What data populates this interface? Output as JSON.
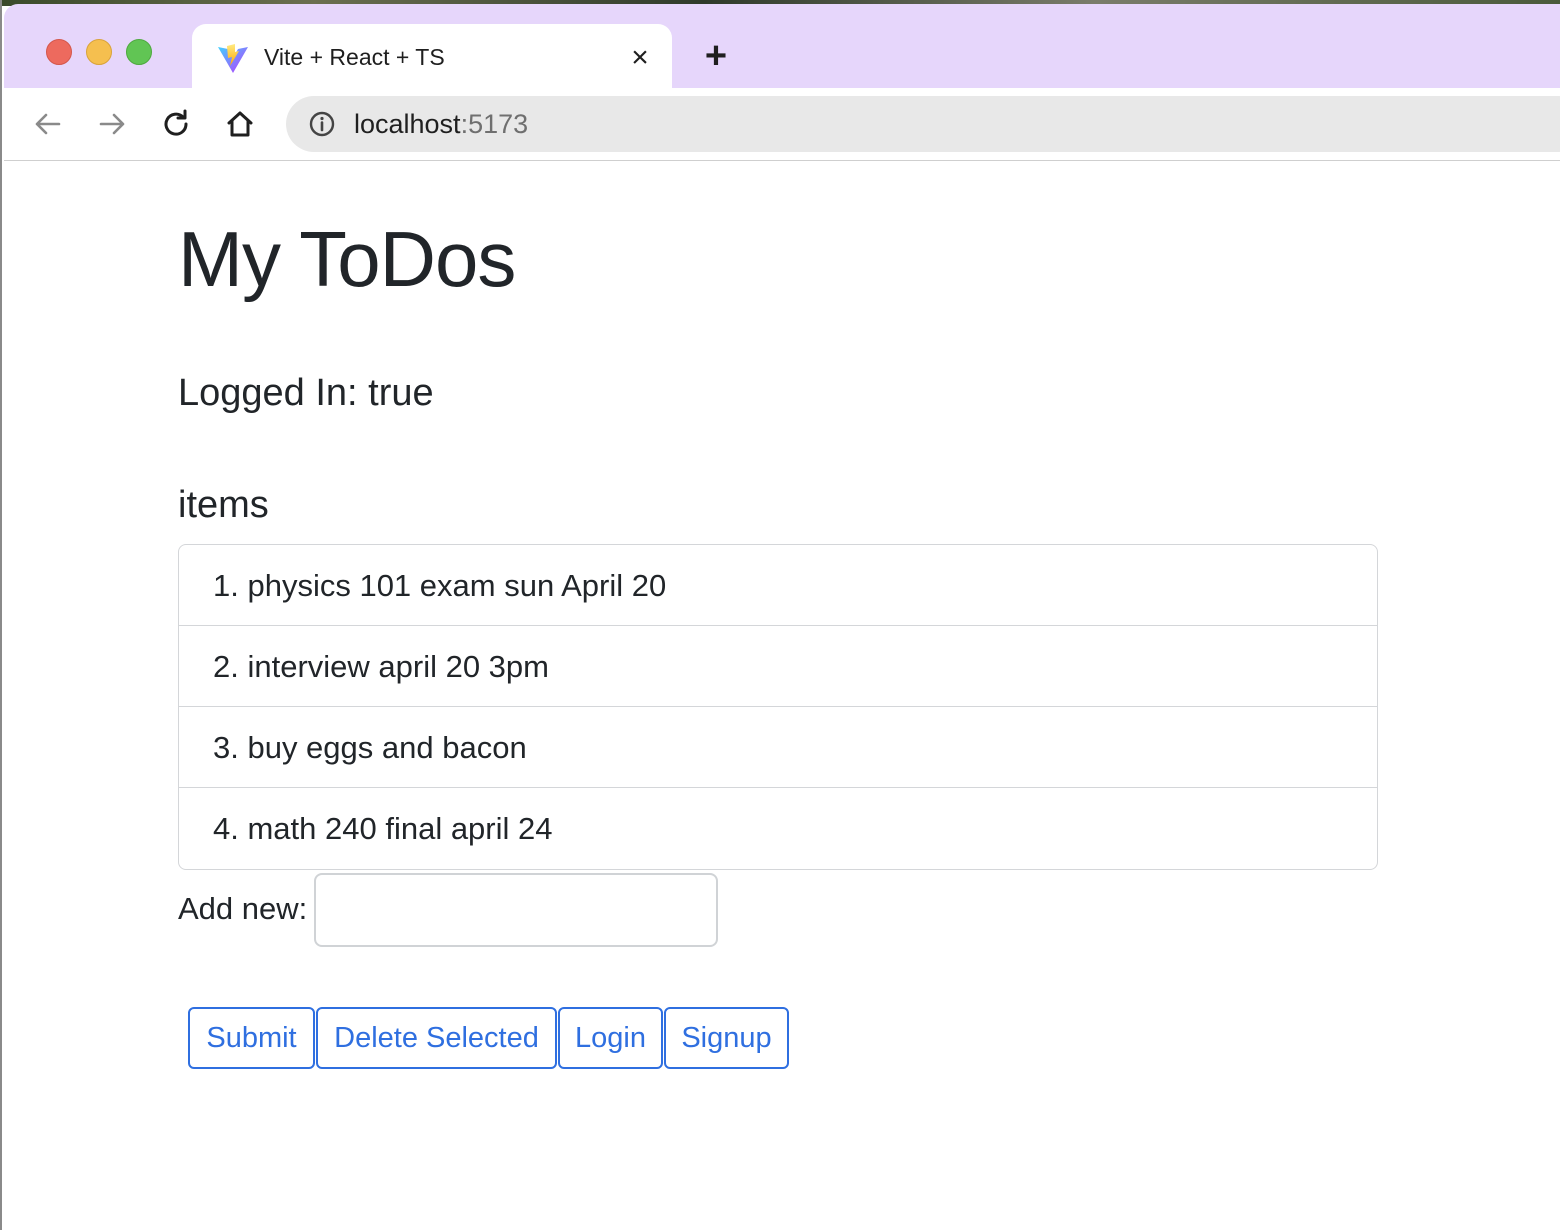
{
  "browser": {
    "tab_title": "Vite + React + TS",
    "tab_close_glyph": "×",
    "new_tab_glyph": "+",
    "url_host": "localhost",
    "url_port": ":5173",
    "favicon": "vite-logo-icon"
  },
  "page": {
    "title": "My ToDos",
    "logged_in": "Logged In: true",
    "items_heading": "items",
    "items": [
      "1. physics 101 exam sun April 20",
      "2. interview april 20 3pm",
      "3. buy eggs and bacon",
      "4. math 240 final april 24"
    ],
    "add_label": "Add new:",
    "add_input_value": "",
    "buttons": {
      "submit": "Submit",
      "delete_selected": "Delete Selected",
      "login": "Login",
      "signup": "Signup"
    }
  },
  "colors": {
    "tabbar_bg": "#e6d6fb",
    "button_accent": "#2f6fe0",
    "text": "#212529"
  }
}
